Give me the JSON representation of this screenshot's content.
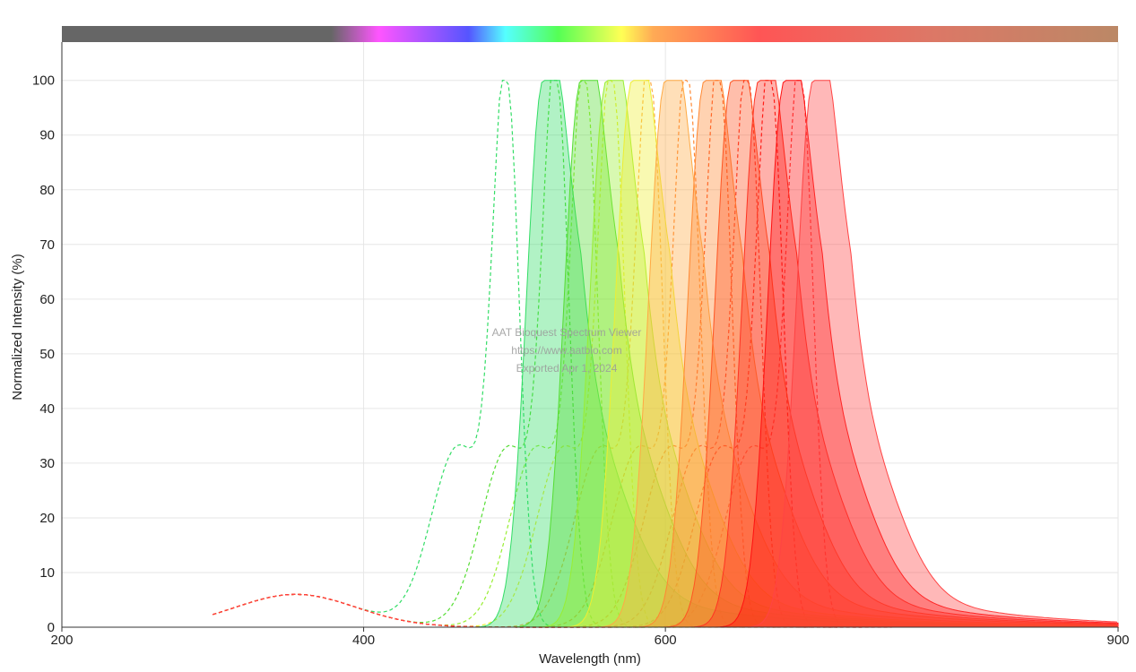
{
  "watermark": {
    "line1": "AAT Bioquest Spectrum Viewer",
    "line2": "https://www.aatbio.com",
    "line3": "Exported Apr 1, 2024"
  },
  "chart_data": {
    "type": "area",
    "xlabel": "Wavelength (nm)",
    "ylabel": "Normalized Intensity (%)",
    "xlim": [
      200,
      900
    ],
    "ylim": [
      0,
      107
    ],
    "x_ticks": [
      200,
      400,
      600,
      900
    ],
    "y_ticks": [
      0,
      10,
      20,
      30,
      40,
      50,
      60,
      70,
      80,
      90,
      100
    ],
    "grid": true,
    "legend": "none",
    "spectrum_bar": true,
    "series": [
      {
        "color": "#33dd66",
        "excitation_peak": 495,
        "emission_peak": 519
      },
      {
        "color": "#55dd33",
        "excitation_peak": 528,
        "emission_peak": 544
      },
      {
        "color": "#99ee33",
        "excitation_peak": 547,
        "emission_peak": 561
      },
      {
        "color": "#eeee33",
        "excitation_peak": 565,
        "emission_peak": 578
      },
      {
        "color": "#ffaa44",
        "excitation_peak": 590,
        "emission_peak": 600
      },
      {
        "color": "#ff8833",
        "excitation_peak": 615,
        "emission_peak": 626
      },
      {
        "color": "#ff5522",
        "excitation_peak": 636,
        "emission_peak": 644
      },
      {
        "color": "#ff3322",
        "excitation_peak": 655,
        "emission_peak": 662
      },
      {
        "color": "#ff1111",
        "excitation_peak": 670,
        "emission_peak": 679
      },
      {
        "color": "#ff4444",
        "excitation_peak": 690,
        "emission_peak": 698
      }
    ]
  }
}
